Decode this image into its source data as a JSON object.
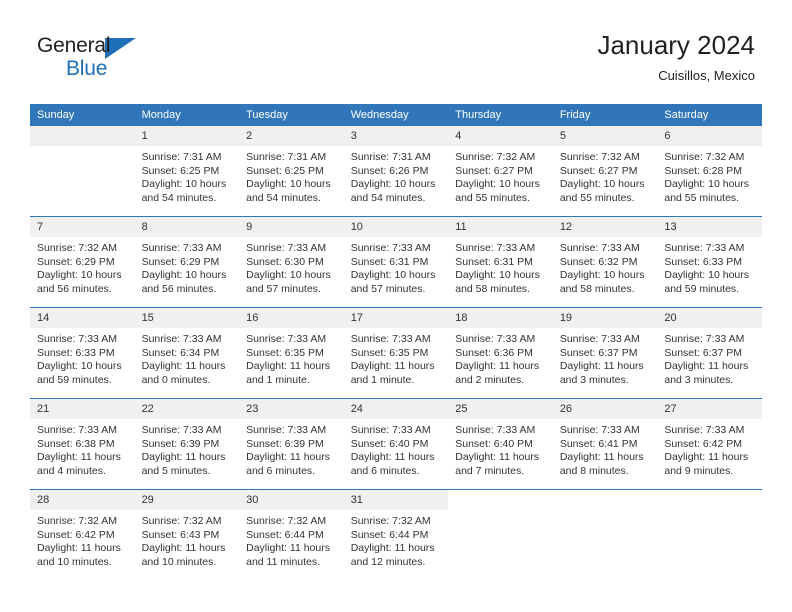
{
  "brand": {
    "name_top": "General",
    "name_bottom": "Blue",
    "accent_color": "#1d70b7",
    "logo_icon": "triangle-flag-icon"
  },
  "header": {
    "title": "January 2024",
    "subtitle": "Cuisillos, Mexico"
  },
  "theme": {
    "header_bar_color": "#3176b9",
    "daynum_band_color": "#f0f0f0",
    "text_color": "#333333"
  },
  "calendar": {
    "weekday_headers": [
      "Sunday",
      "Monday",
      "Tuesday",
      "Wednesday",
      "Thursday",
      "Friday",
      "Saturday"
    ],
    "labels": {
      "sunrise": "Sunrise:",
      "sunset": "Sunset:",
      "daylight": "Daylight:"
    },
    "weeks": [
      [
        {
          "day": "",
          "empty": true
        },
        {
          "day": "1",
          "sunrise": "Sunrise: 7:31 AM",
          "sunset": "Sunset: 6:25 PM",
          "daylight_line1": "Daylight: 10 hours",
          "daylight_line2": "and 54 minutes."
        },
        {
          "day": "2",
          "sunrise": "Sunrise: 7:31 AM",
          "sunset": "Sunset: 6:25 PM",
          "daylight_line1": "Daylight: 10 hours",
          "daylight_line2": "and 54 minutes."
        },
        {
          "day": "3",
          "sunrise": "Sunrise: 7:31 AM",
          "sunset": "Sunset: 6:26 PM",
          "daylight_line1": "Daylight: 10 hours",
          "daylight_line2": "and 54 minutes."
        },
        {
          "day": "4",
          "sunrise": "Sunrise: 7:32 AM",
          "sunset": "Sunset: 6:27 PM",
          "daylight_line1": "Daylight: 10 hours",
          "daylight_line2": "and 55 minutes."
        },
        {
          "day": "5",
          "sunrise": "Sunrise: 7:32 AM",
          "sunset": "Sunset: 6:27 PM",
          "daylight_line1": "Daylight: 10 hours",
          "daylight_line2": "and 55 minutes."
        },
        {
          "day": "6",
          "sunrise": "Sunrise: 7:32 AM",
          "sunset": "Sunset: 6:28 PM",
          "daylight_line1": "Daylight: 10 hours",
          "daylight_line2": "and 55 minutes."
        }
      ],
      [
        {
          "day": "7",
          "sunrise": "Sunrise: 7:32 AM",
          "sunset": "Sunset: 6:29 PM",
          "daylight_line1": "Daylight: 10 hours",
          "daylight_line2": "and 56 minutes."
        },
        {
          "day": "8",
          "sunrise": "Sunrise: 7:33 AM",
          "sunset": "Sunset: 6:29 PM",
          "daylight_line1": "Daylight: 10 hours",
          "daylight_line2": "and 56 minutes."
        },
        {
          "day": "9",
          "sunrise": "Sunrise: 7:33 AM",
          "sunset": "Sunset: 6:30 PM",
          "daylight_line1": "Daylight: 10 hours",
          "daylight_line2": "and 57 minutes."
        },
        {
          "day": "10",
          "sunrise": "Sunrise: 7:33 AM",
          "sunset": "Sunset: 6:31 PM",
          "daylight_line1": "Daylight: 10 hours",
          "daylight_line2": "and 57 minutes."
        },
        {
          "day": "11",
          "sunrise": "Sunrise: 7:33 AM",
          "sunset": "Sunset: 6:31 PM",
          "daylight_line1": "Daylight: 10 hours",
          "daylight_line2": "and 58 minutes."
        },
        {
          "day": "12",
          "sunrise": "Sunrise: 7:33 AM",
          "sunset": "Sunset: 6:32 PM",
          "daylight_line1": "Daylight: 10 hours",
          "daylight_line2": "and 58 minutes."
        },
        {
          "day": "13",
          "sunrise": "Sunrise: 7:33 AM",
          "sunset": "Sunset: 6:33 PM",
          "daylight_line1": "Daylight: 10 hours",
          "daylight_line2": "and 59 minutes."
        }
      ],
      [
        {
          "day": "14",
          "sunrise": "Sunrise: 7:33 AM",
          "sunset": "Sunset: 6:33 PM",
          "daylight_line1": "Daylight: 10 hours",
          "daylight_line2": "and 59 minutes."
        },
        {
          "day": "15",
          "sunrise": "Sunrise: 7:33 AM",
          "sunset": "Sunset: 6:34 PM",
          "daylight_line1": "Daylight: 11 hours",
          "daylight_line2": "and 0 minutes."
        },
        {
          "day": "16",
          "sunrise": "Sunrise: 7:33 AM",
          "sunset": "Sunset: 6:35 PM",
          "daylight_line1": "Daylight: 11 hours",
          "daylight_line2": "and 1 minute."
        },
        {
          "day": "17",
          "sunrise": "Sunrise: 7:33 AM",
          "sunset": "Sunset: 6:35 PM",
          "daylight_line1": "Daylight: 11 hours",
          "daylight_line2": "and 1 minute."
        },
        {
          "day": "18",
          "sunrise": "Sunrise: 7:33 AM",
          "sunset": "Sunset: 6:36 PM",
          "daylight_line1": "Daylight: 11 hours",
          "daylight_line2": "and 2 minutes."
        },
        {
          "day": "19",
          "sunrise": "Sunrise: 7:33 AM",
          "sunset": "Sunset: 6:37 PM",
          "daylight_line1": "Daylight: 11 hours",
          "daylight_line2": "and 3 minutes."
        },
        {
          "day": "20",
          "sunrise": "Sunrise: 7:33 AM",
          "sunset": "Sunset: 6:37 PM",
          "daylight_line1": "Daylight: 11 hours",
          "daylight_line2": "and 3 minutes."
        }
      ],
      [
        {
          "day": "21",
          "sunrise": "Sunrise: 7:33 AM",
          "sunset": "Sunset: 6:38 PM",
          "daylight_line1": "Daylight: 11 hours",
          "daylight_line2": "and 4 minutes."
        },
        {
          "day": "22",
          "sunrise": "Sunrise: 7:33 AM",
          "sunset": "Sunset: 6:39 PM",
          "daylight_line1": "Daylight: 11 hours",
          "daylight_line2": "and 5 minutes."
        },
        {
          "day": "23",
          "sunrise": "Sunrise: 7:33 AM",
          "sunset": "Sunset: 6:39 PM",
          "daylight_line1": "Daylight: 11 hours",
          "daylight_line2": "and 6 minutes."
        },
        {
          "day": "24",
          "sunrise": "Sunrise: 7:33 AM",
          "sunset": "Sunset: 6:40 PM",
          "daylight_line1": "Daylight: 11 hours",
          "daylight_line2": "and 6 minutes."
        },
        {
          "day": "25",
          "sunrise": "Sunrise: 7:33 AM",
          "sunset": "Sunset: 6:40 PM",
          "daylight_line1": "Daylight: 11 hours",
          "daylight_line2": "and 7 minutes."
        },
        {
          "day": "26",
          "sunrise": "Sunrise: 7:33 AM",
          "sunset": "Sunset: 6:41 PM",
          "daylight_line1": "Daylight: 11 hours",
          "daylight_line2": "and 8 minutes."
        },
        {
          "day": "27",
          "sunrise": "Sunrise: 7:33 AM",
          "sunset": "Sunset: 6:42 PM",
          "daylight_line1": "Daylight: 11 hours",
          "daylight_line2": "and 9 minutes."
        }
      ],
      [
        {
          "day": "28",
          "sunrise": "Sunrise: 7:32 AM",
          "sunset": "Sunset: 6:42 PM",
          "daylight_line1": "Daylight: 11 hours",
          "daylight_line2": "and 10 minutes."
        },
        {
          "day": "29",
          "sunrise": "Sunrise: 7:32 AM",
          "sunset": "Sunset: 6:43 PM",
          "daylight_line1": "Daylight: 11 hours",
          "daylight_line2": "and 10 minutes."
        },
        {
          "day": "30",
          "sunrise": "Sunrise: 7:32 AM",
          "sunset": "Sunset: 6:44 PM",
          "daylight_line1": "Daylight: 11 hours",
          "daylight_line2": "and 11 minutes."
        },
        {
          "day": "31",
          "sunrise": "Sunrise: 7:32 AM",
          "sunset": "Sunset: 6:44 PM",
          "daylight_line1": "Daylight: 11 hours",
          "daylight_line2": "and 12 minutes."
        },
        {
          "day": "",
          "empty": true,
          "blank": true
        },
        {
          "day": "",
          "empty": true,
          "blank": true
        },
        {
          "day": "",
          "empty": true,
          "blank": true
        }
      ]
    ]
  }
}
